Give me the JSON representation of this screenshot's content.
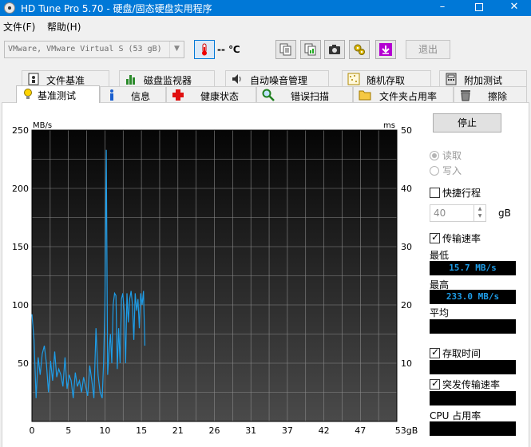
{
  "window": {
    "title": "HD Tune Pro 5.70 - 硬盘/固态硬盘实用程序",
    "min": "–",
    "close": "✕"
  },
  "menu": {
    "file": "文件(F)",
    "help": "帮助(H)"
  },
  "toolbar": {
    "drive": "VMware, VMware Virtual S (53 gB)",
    "temperature": "-- ℃",
    "exit": "退出"
  },
  "tabs": {
    "top": [
      "文件基准",
      "磁盘监视器",
      "自动噪音管理",
      "随机存取",
      "附加测试"
    ],
    "bottom": [
      "基准测试",
      "信息",
      "健康状态",
      "错误扫描",
      "文件夹占用率",
      "擦除"
    ],
    "active": "基准测试"
  },
  "controls": {
    "stop": "停止",
    "read": "读取",
    "write": "写入",
    "quick_stroke": "快捷行程",
    "quick_value": "40",
    "quick_unit": "gB",
    "transfer_rate": "传输速率",
    "min_label": "最低",
    "min_value": "15.7 MB/s",
    "max_label": "最高",
    "max_value": "233.0 MB/s",
    "avg_label": "平均",
    "avg_value": "",
    "access_time": "存取时间",
    "access_value": "",
    "burst_rate": "突发传输速率",
    "burst_value": "",
    "cpu_label": "CPU 占用率",
    "cpu_value": ""
  },
  "colors": {
    "line": "#1e9de8",
    "lcd_text": "#1e9de8",
    "titlebar": "#0078d7"
  },
  "chart_data": {
    "type": "line",
    "ylabel": "MB/s",
    "y2label": "ms",
    "ylim": [
      0,
      250
    ],
    "y2lim": [
      0,
      50
    ],
    "xlim": [
      0,
      53
    ],
    "yticks": [
      50,
      100,
      150,
      200,
      250
    ],
    "y2ticks": [
      10,
      20,
      30,
      40,
      50
    ],
    "xticks": [
      "0",
      "5",
      "10",
      "15",
      "21",
      "26",
      "31",
      "37",
      "42",
      "47",
      "53gB"
    ],
    "grid": true,
    "series": [
      {
        "x": [
          0,
          0.3,
          0.6,
          0.9,
          1.2,
          1.5,
          1.8,
          2.1,
          2.4,
          2.7,
          3.0,
          3.3,
          3.6,
          3.9,
          4.2,
          4.5,
          4.8,
          5.1,
          5.4,
          5.7,
          6.0,
          6.3,
          6.6,
          6.9,
          7.2,
          7.5,
          7.8,
          8.1,
          8.4,
          8.7,
          9.0,
          9.3,
          9.6,
          9.9,
          10.2,
          10.4,
          10.6,
          10.8,
          11.0,
          11.2,
          11.4,
          11.6,
          11.8,
          12.0,
          12.2,
          12.4,
          12.6,
          12.8,
          13.0,
          13.2,
          13.4,
          13.6,
          13.8,
          14.0,
          14.2,
          14.4,
          14.6,
          14.8,
          15.0,
          15.2,
          15.4,
          15.6,
          15.8,
          16.0,
          16.2,
          16.4
        ],
        "values": [
          92,
          70,
          20,
          55,
          40,
          58,
          65,
          50,
          25,
          52,
          35,
          60,
          38,
          45,
          40,
          30,
          55,
          28,
          40,
          35,
          20,
          42,
          30,
          35,
          25,
          38,
          30,
          22,
          48,
          35,
          20,
          80,
          40,
          25,
          20,
          50,
          100,
          233,
          40,
          60,
          75,
          50,
          100,
          110,
          108,
          45,
          80,
          50,
          105,
          110,
          95,
          50,
          110,
          85,
          105,
          112,
          100,
          70,
          110,
          95,
          105,
          80,
          110,
          100,
          112,
          65
        ]
      }
    ]
  }
}
